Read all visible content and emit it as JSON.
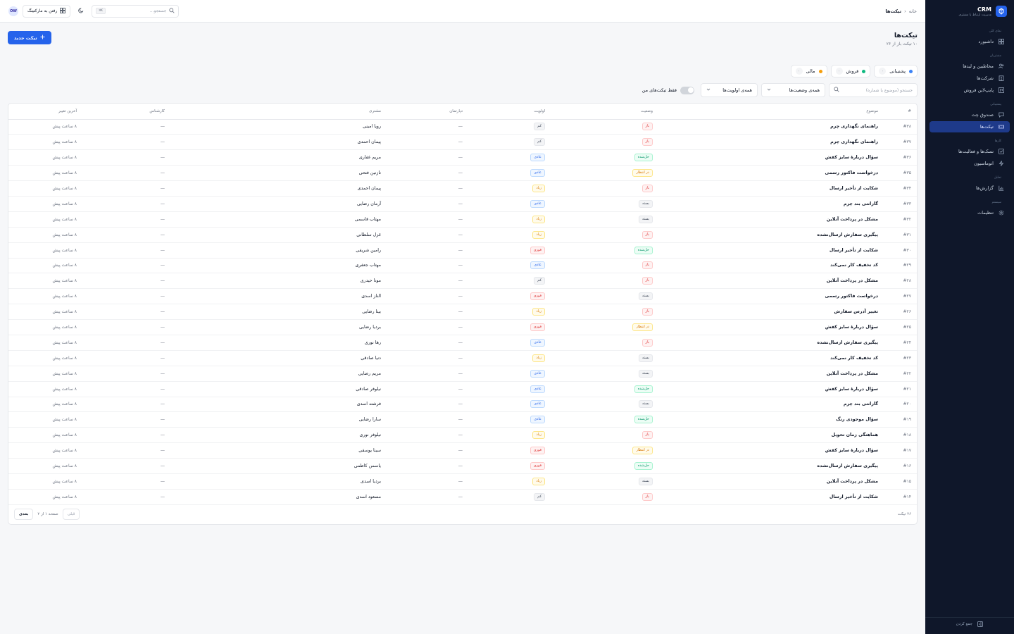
{
  "brand": {
    "name": "CRM",
    "subtitle": "مدیریت ارتباط با مشتری"
  },
  "sidebar": {
    "sections": [
      {
        "heading": "نمای کلی",
        "items": [
          {
            "label": "داشبورد",
            "icon": "dashboard-icon"
          }
        ]
      },
      {
        "heading": "مشتریان",
        "items": [
          {
            "label": "مخاطبین و لیدها",
            "icon": "users-icon"
          },
          {
            "label": "شرکت‌ها",
            "icon": "building-icon"
          },
          {
            "label": "پایپ‌لاین فروش",
            "icon": "kanban-icon"
          }
        ]
      },
      {
        "heading": "پشتیبانی",
        "items": [
          {
            "label": "صندوق چت",
            "icon": "chat-icon"
          },
          {
            "label": "تیکت‌ها",
            "icon": "ticket-icon",
            "active": true
          }
        ]
      },
      {
        "heading": "کارها",
        "items": [
          {
            "label": "تسک‌ها و فعالیت‌ها",
            "icon": "check-square-icon"
          },
          {
            "label": "اتوماسیون",
            "icon": "zap-icon"
          }
        ]
      },
      {
        "heading": "تحلیل",
        "items": [
          {
            "label": "گزارش‌ها",
            "icon": "bar-chart-icon"
          }
        ]
      },
      {
        "heading": "سیستم",
        "items": [
          {
            "label": "تنظیمات",
            "icon": "gear-icon"
          }
        ]
      }
    ],
    "collapse_label": "جمع کردن"
  },
  "header": {
    "breadcrumb": {
      "home": "خانه",
      "current": "تیکت‌ها"
    },
    "search_placeholder": "جستجو...",
    "search_shortcut": "⌘K",
    "market_button": "رفتن به مارکتینگ",
    "avatar_initials": "OW"
  },
  "page": {
    "title": "تیکت‌ها",
    "subtitle": "۱۰ تیکت باز از ۲۶",
    "new_button": "تیکت جدید"
  },
  "channels": [
    {
      "label": "پشتیبانی",
      "count": "۰",
      "color": "#3b82f6"
    },
    {
      "label": "فروش",
      "count": "۰",
      "color": "#10b981"
    },
    {
      "label": "مالی",
      "count": "۰",
      "color": "#f59e0b"
    }
  ],
  "filters": {
    "search_placeholder": "جستجو (موضوع یا شماره)",
    "status_select": "همه‌ی وضعیت‌ها",
    "priority_select": "همه‌ی اولویت‌ها",
    "mine_toggle": "فقط تیکت‌های من"
  },
  "table": {
    "columns": [
      "#",
      "موضوع",
      "وضعیت",
      "اولویت",
      "دپارتمان",
      "مشتری",
      "کارشناس",
      "آخرین تغییر"
    ],
    "rows": [
      {
        "num": "#۳۸",
        "subject": "راهنمای نگهداری چرم",
        "status": "باز",
        "priority": "کم",
        "dept": "—",
        "customer": "رویا امینی",
        "agent": "—",
        "updated": "۸ ساعت پیش"
      },
      {
        "num": "#۳۷",
        "subject": "راهنمای نگهداری چرم",
        "status": "باز",
        "priority": "کم",
        "dept": "—",
        "customer": "پیمان احمدی",
        "agent": "—",
        "updated": "۸ ساعت پیش"
      },
      {
        "num": "#۳۶",
        "subject": "سؤال دربارهٔ سایز کفش",
        "status": "حل‌شده",
        "priority": "عادی",
        "dept": "—",
        "customer": "مریم غفاری",
        "agent": "—",
        "updated": "۸ ساعت پیش"
      },
      {
        "num": "#۳۵",
        "subject": "درخواست فاکتور رسمی",
        "status": "در انتظار",
        "priority": "عادی",
        "dept": "—",
        "customer": "نازنین فتحی",
        "agent": "—",
        "updated": "۸ ساعت پیش"
      },
      {
        "num": "#۳۴",
        "subject": "شکایت از تأخیر ارسال",
        "status": "باز",
        "priority": "زیاد",
        "dept": "—",
        "customer": "پیمان احمدی",
        "agent": "—",
        "updated": "۸ ساعت پیش"
      },
      {
        "num": "#۳۳",
        "subject": "گارانتی بند چرم",
        "status": "بسته",
        "priority": "عادی",
        "dept": "—",
        "customer": "آرمان رضایی",
        "agent": "—",
        "updated": "۸ ساعت پیش"
      },
      {
        "num": "#۳۲",
        "subject": "مشکل در پرداخت آنلاین",
        "status": "بسته",
        "priority": "زیاد",
        "dept": "—",
        "customer": "مهتاب قاسمی",
        "agent": "—",
        "updated": "۸ ساعت پیش"
      },
      {
        "num": "#۳۱",
        "subject": "پیگیری سفارش ارسال‌نشده",
        "status": "باز",
        "priority": "زیاد",
        "dept": "—",
        "customer": "غزل سلطانی",
        "agent": "—",
        "updated": "۸ ساعت پیش"
      },
      {
        "num": "#۳۰",
        "subject": "شکایت از تأخیر ارسال",
        "status": "حل‌شده",
        "priority": "فوری",
        "dept": "—",
        "customer": "رامین شریفی",
        "agent": "—",
        "updated": "۸ ساعت پیش"
      },
      {
        "num": "#۲۹",
        "subject": "کد تخفیف کار نمی‌کند",
        "status": "باز",
        "priority": "عادی",
        "dept": "—",
        "customer": "مهتاب جعفری",
        "agent": "—",
        "updated": "۸ ساعت پیش"
      },
      {
        "num": "#۲۸",
        "subject": "مشکل در پرداخت آنلاین",
        "status": "باز",
        "priority": "کم",
        "dept": "—",
        "customer": "مونا حیدری",
        "agent": "—",
        "updated": "۸ ساعت پیش"
      },
      {
        "num": "#۲۷",
        "subject": "درخواست فاکتور رسمی",
        "status": "بسته",
        "priority": "فوری",
        "dept": "—",
        "customer": "الناز اسدی",
        "agent": "—",
        "updated": "۸ ساعت پیش"
      },
      {
        "num": "#۲۶",
        "subject": "تغییر آدرس سفارش",
        "status": "باز",
        "priority": "زیاد",
        "dept": "—",
        "customer": "بیتا رضایی",
        "agent": "—",
        "updated": "۸ ساعت پیش"
      },
      {
        "num": "#۲۵",
        "subject": "سؤال دربارهٔ سایز کفش",
        "status": "در انتظار",
        "priority": "فوری",
        "dept": "—",
        "customer": "بردیا رضایی",
        "agent": "—",
        "updated": "۸ ساعت پیش"
      },
      {
        "num": "#۲۴",
        "subject": "پیگیری سفارش ارسال‌نشده",
        "status": "باز",
        "priority": "عادی",
        "dept": "—",
        "customer": "رها نوری",
        "agent": "—",
        "updated": "۸ ساعت پیش"
      },
      {
        "num": "#۲۳",
        "subject": "کد تخفیف کار نمی‌کند",
        "status": "بسته",
        "priority": "زیاد",
        "dept": "—",
        "customer": "دنیا صادقی",
        "agent": "—",
        "updated": "۸ ساعت پیش"
      },
      {
        "num": "#۲۲",
        "subject": "مشکل در پرداخت آنلاین",
        "status": "بسته",
        "priority": "عادی",
        "dept": "—",
        "customer": "مریم رضایی",
        "agent": "—",
        "updated": "۸ ساعت پیش"
      },
      {
        "num": "#۲۱",
        "subject": "سؤال دربارهٔ سایز کفش",
        "status": "حل‌شده",
        "priority": "عادی",
        "dept": "—",
        "customer": "نیلوفر صادقی",
        "agent": "—",
        "updated": "۸ ساعت پیش"
      },
      {
        "num": "#۲۰",
        "subject": "گارانتی بند چرم",
        "status": "بسته",
        "priority": "عادی",
        "dept": "—",
        "customer": "فرشته اسدی",
        "agent": "—",
        "updated": "۸ ساعت پیش"
      },
      {
        "num": "#۱۹",
        "subject": "سؤال موجودی رنگ",
        "status": "حل‌شده",
        "priority": "عادی",
        "dept": "—",
        "customer": "سارا رضایی",
        "agent": "—",
        "updated": "۸ ساعت پیش"
      },
      {
        "num": "#۱۸",
        "subject": "هماهنگی زمان تحویل",
        "status": "باز",
        "priority": "زیاد",
        "dept": "—",
        "customer": "نیلوفر نوری",
        "agent": "—",
        "updated": "۸ ساعت پیش"
      },
      {
        "num": "#۱۷",
        "subject": "سؤال دربارهٔ سایز کفش",
        "status": "در انتظار",
        "priority": "فوری",
        "dept": "—",
        "customer": "سینا یوسفی",
        "agent": "—",
        "updated": "۸ ساعت پیش"
      },
      {
        "num": "#۱۶",
        "subject": "پیگیری سفارش ارسال‌نشده",
        "status": "حل‌شده",
        "priority": "فوری",
        "dept": "—",
        "customer": "یاسمن کاظمی",
        "agent": "—",
        "updated": "۸ ساعت پیش"
      },
      {
        "num": "#۱۵",
        "subject": "مشکل در پرداخت آنلاین",
        "status": "بسته",
        "priority": "زیاد",
        "dept": "—",
        "customer": "بردیا اسدی",
        "agent": "—",
        "updated": "۸ ساعت پیش"
      },
      {
        "num": "#۱۴",
        "subject": "شکایت از تأخیر ارسال",
        "status": "باز",
        "priority": "کم",
        "dept": "—",
        "customer": "مسعود اسدی",
        "agent": "—",
        "updated": "۸ ساعت پیش"
      }
    ],
    "footer_count": "۲۶ تیکت",
    "pager": {
      "prev": "قبلی",
      "info": "صفحه ۱ از ۲",
      "next": "بعدی"
    }
  },
  "colors": {
    "accent": "#2563eb",
    "sidebar_bg": "#0f172a",
    "sidebar_active": "#1e3a8a"
  }
}
